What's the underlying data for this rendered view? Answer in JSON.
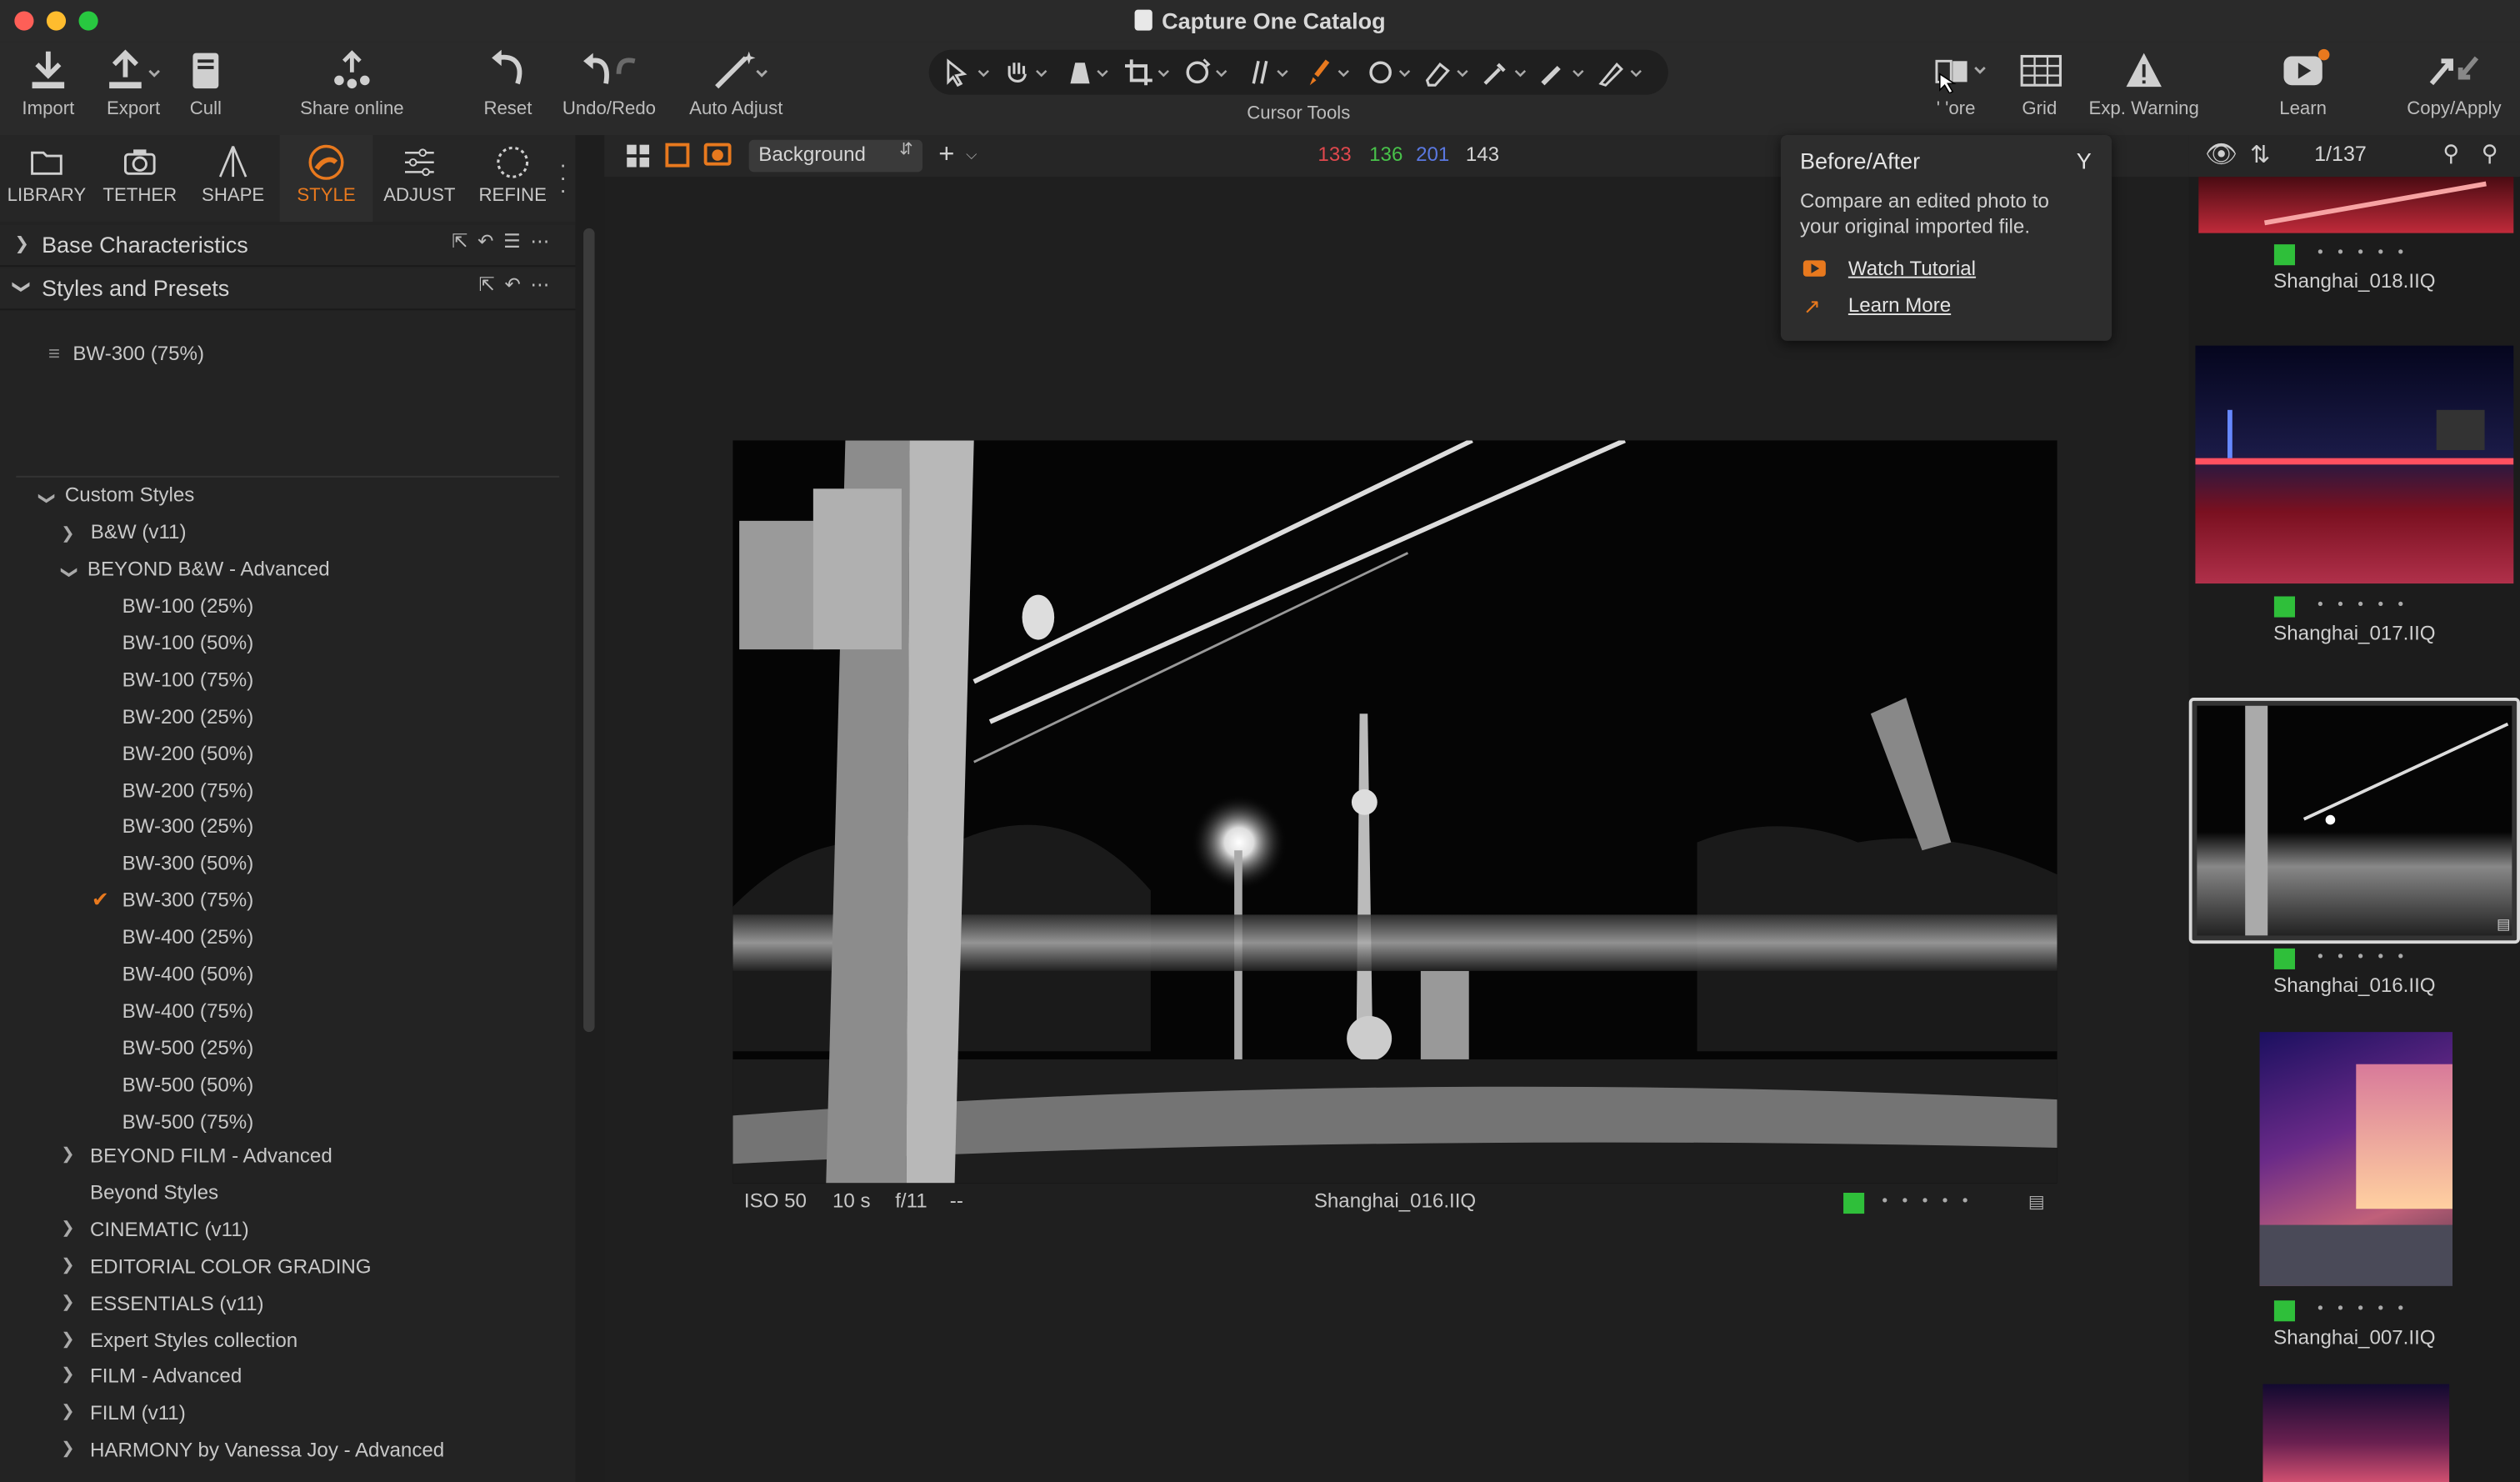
{
  "window": {
    "title": "Capture One Catalog"
  },
  "toolbar": {
    "import": "Import",
    "export": "Export",
    "cull": "Cull",
    "share": "Share online",
    "reset": "Reset",
    "undo_redo": "Undo/Redo",
    "auto_adjust": "Auto Adjust",
    "cursor_tools": "Cursor Tools",
    "before_after": "' 'ore",
    "grid": "Grid",
    "exp_warning": "Exp. Warning",
    "learn": "Learn",
    "copy_apply": "Copy/Apply"
  },
  "tabs": [
    "LIBRARY",
    "TETHER",
    "SHAPE",
    "STYLE",
    "ADJUST",
    "REFINE"
  ],
  "active_tab": "STYLE",
  "left_panel": {
    "base_characteristics": "Base Characteristics",
    "styles_presets": "Styles and Presets",
    "applied_style": "BW-300 (75%)",
    "custom_styles": "Custom Styles",
    "groups_top": [
      "B&W (v11)"
    ],
    "advanced_group": "BEYOND B&W - Advanced",
    "advanced_items": [
      "BW-100 (25%)",
      "BW-100 (50%)",
      "BW-100 (75%)",
      "BW-200 (25%)",
      "BW-200 (50%)",
      "BW-200 (75%)",
      "BW-300 (25%)",
      "BW-300 (50%)",
      "BW-300 (75%)",
      "BW-400 (25%)",
      "BW-400 (50%)",
      "BW-400 (75%)",
      "BW-500 (25%)",
      "BW-500 (50%)",
      "BW-500 (75%)"
    ],
    "checked_item": "BW-300 (75%)",
    "groups_bottom": [
      "BEYOND FILM - Advanced",
      "Beyond Styles",
      "CINEMATIC (v11)",
      "EDITORIAL COLOR GRADING",
      "ESSENTIALS (v11)",
      "Expert Styles collection",
      "FILM - Advanced",
      "FILM (v11)",
      "HARMONY by Vanessa Joy - Advanced"
    ],
    "groups_bottom_expandable": [
      true,
      false,
      true,
      true,
      true,
      true,
      true,
      true,
      true
    ]
  },
  "viewer": {
    "background_label": "Background",
    "rgb": {
      "r": "133",
      "g": "136",
      "b": "201",
      "l": "143"
    },
    "iso": "ISO 50",
    "shutter": "10 s",
    "aperture": "f/11",
    "extra": "--",
    "filename": "Shanghai_016.IIQ"
  },
  "popover": {
    "title": "Before/After",
    "shortcut": "Y",
    "body": "Compare an edited photo to your original imported file.",
    "watch": "Watch Tutorial",
    "learn": "Learn More"
  },
  "browser": {
    "count": "1/137",
    "thumbs": [
      "Shanghai_018.IIQ",
      "Shanghai_017.IIQ",
      "Shanghai_016.IIQ",
      "Shanghai_007.IIQ"
    ],
    "selected": "Shanghai_016.IIQ"
  },
  "colors": {
    "accent": "#e8791e",
    "green_tag": "#2fbf3a",
    "red": "#e0484d",
    "green": "#48c24a",
    "blue": "#5a78e0"
  }
}
